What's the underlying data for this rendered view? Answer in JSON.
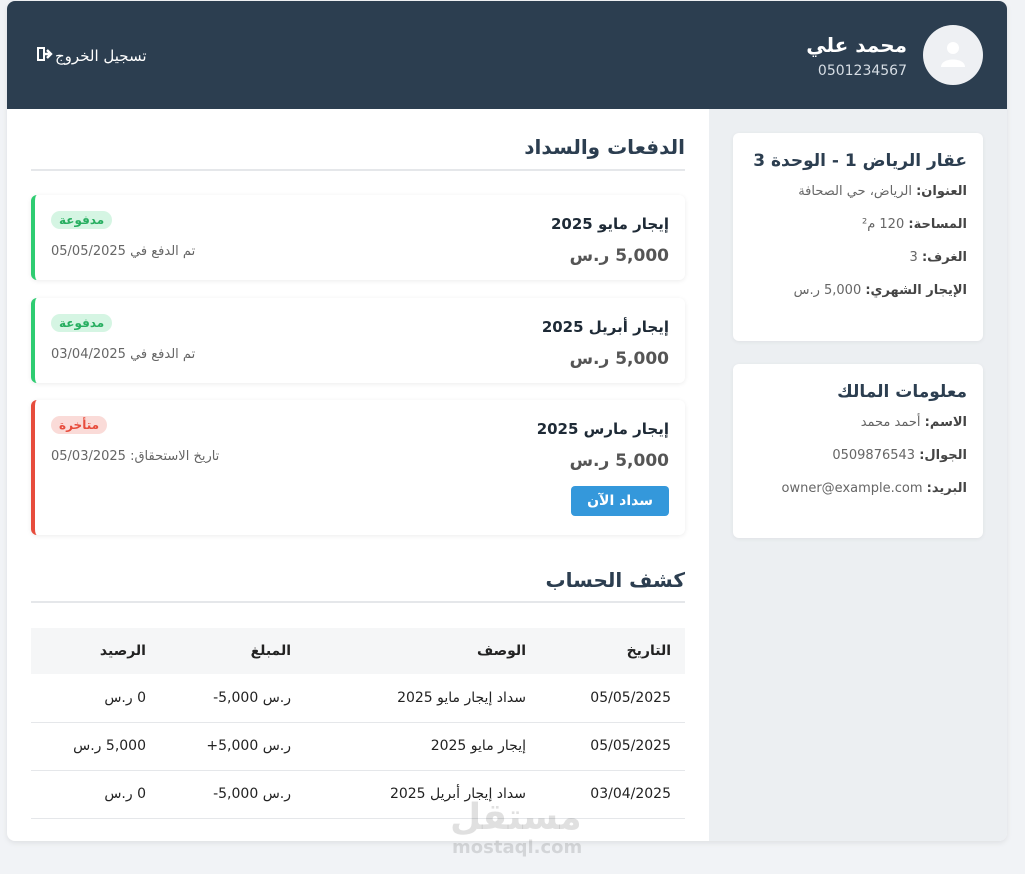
{
  "header": {
    "user_name": "محمد علي",
    "user_phone": "0501234567",
    "logout_label": "تسجيل الخروج",
    "avatar_icon": "user-icon",
    "logout_icon": "sign-out-icon"
  },
  "payments": {
    "title": "الدفعات والسداد",
    "items": [
      {
        "title": "إيجار مايو 2025",
        "amount": "5,000 ر.س",
        "status": "مدفوعة",
        "note": "تم الدفع في 05/05/2025"
      },
      {
        "title": "إيجار أبريل 2025",
        "amount": "5,000 ر.س",
        "status": "مدفوعة",
        "note": "تم الدفع في 03/04/2025"
      },
      {
        "title": "إيجار مارس 2025",
        "amount": "5,000 ر.س",
        "status": "متأخرة",
        "note": "تاريخ الاستحقاق: 05/03/2025",
        "action": "سداد الآن"
      }
    ]
  },
  "statement": {
    "title": "كشف الحساب",
    "headers": [
      "التاريخ",
      "الوصف",
      "المبلغ",
      "الرصيد"
    ],
    "rows": [
      {
        "date": "05/05/2025",
        "desc": "سداد إيجار مايو 2025",
        "amount": "-5,000 ر.س",
        "balance": "0 ر.س"
      },
      {
        "date": "05/05/2025",
        "desc": "إيجار مايو 2025",
        "amount": "+5,000 ر.س",
        "balance": "5,000 ر.س"
      },
      {
        "date": "03/04/2025",
        "desc": "سداد إيجار أبريل 2025",
        "amount": "-5,000 ر.س",
        "balance": "0 ر.س"
      }
    ]
  },
  "property": {
    "title": "عقار الرياض 1 - الوحدة 3",
    "address_label": "العنوان:",
    "address": "الرياض، حي الصحافة",
    "area_label": "المساحة:",
    "area": "120 م²",
    "rooms_label": "الغرف:",
    "rooms": "3",
    "rent_label": "الإيجار الشهري:",
    "rent": "5,000 ر.س"
  },
  "owner": {
    "title": "معلومات المالك",
    "name_label": "الاسم:",
    "name": "أحمد محمد",
    "mobile_label": "الجوال:",
    "mobile": "0509876543",
    "email_label": "البريد:",
    "email": "owner@example.com"
  },
  "watermark": {
    "brand": "مستقل",
    "domain": "mostaql.com"
  },
  "colors": {
    "header": "#2c3e50",
    "paid": "#2ecc71",
    "late": "#e74c3c",
    "button": "#3498db"
  }
}
